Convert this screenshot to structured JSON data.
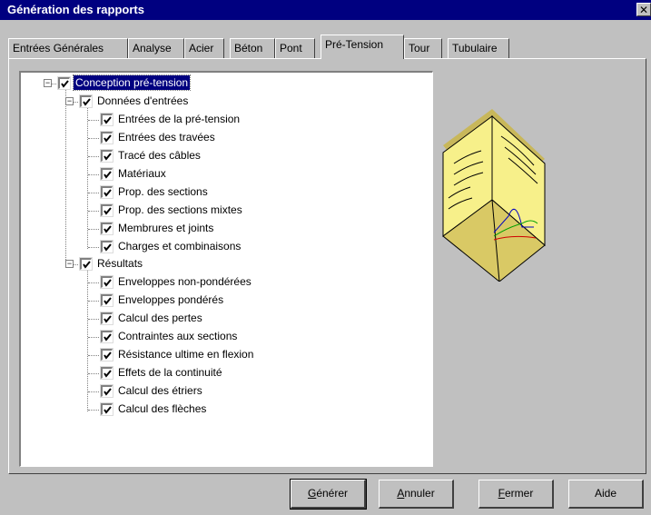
{
  "window": {
    "title": "Génération des rapports",
    "close_glyph": "✕"
  },
  "tabs": [
    {
      "label": "Entrées Générales",
      "active": false
    },
    {
      "label": "Analyse",
      "active": false
    },
    {
      "label": "Acier",
      "active": false
    },
    {
      "label": "Béton",
      "active": false
    },
    {
      "label": "Pont",
      "active": false
    },
    {
      "label": "Pré-Tension",
      "active": true
    },
    {
      "label": "Tour",
      "active": false
    },
    {
      "label": "Tubulaire",
      "active": false
    }
  ],
  "tree": {
    "root": {
      "label": "Conception pré-tension",
      "checked": true,
      "expanded": true,
      "selected": true
    },
    "groups": [
      {
        "label": "Données d'entrées",
        "checked": true,
        "expanded": true,
        "items": [
          {
            "label": "Entrées de la pré-tension",
            "checked": true
          },
          {
            "label": "Entrées des travées",
            "checked": true
          },
          {
            "label": "Tracé des câbles",
            "checked": true
          },
          {
            "label": "Matériaux",
            "checked": true
          },
          {
            "label": "Prop. des sections",
            "checked": true
          },
          {
            "label": "Prop. des sections mixtes",
            "checked": true
          },
          {
            "label": "Membrures et joints",
            "checked": true
          },
          {
            "label": "Charges et combinaisons",
            "checked": true
          }
        ]
      },
      {
        "label": "Résultats",
        "checked": true,
        "expanded": true,
        "items": [
          {
            "label": "Enveloppes non-pondérées",
            "checked": true
          },
          {
            "label": "Enveloppes pondérés",
            "checked": true
          },
          {
            "label": "Calcul des pertes",
            "checked": true
          },
          {
            "label": "Contraintes aux sections",
            "checked": true
          },
          {
            "label": "Résistance ultime en flexion",
            "checked": true
          },
          {
            "label": "Effets de la continuité",
            "checked": true
          },
          {
            "label": "Calcul des étriers",
            "checked": true
          },
          {
            "label": "Calcul des flèches",
            "checked": true
          }
        ]
      }
    ]
  },
  "buttons": {
    "generate": {
      "mnemonic": "G",
      "rest": "énérer"
    },
    "cancel": {
      "mnemonic": "A",
      "rest": "nnuler"
    },
    "close": {
      "mnemonic": "F",
      "rest": "ermer"
    },
    "help": {
      "label": "Aide"
    }
  },
  "illustration": {
    "icon": "open-book-report-icon"
  },
  "colors": {
    "titlebar": "#000080",
    "face": "#c0c0c0",
    "selection": "#000080",
    "book": "#f7f08a"
  }
}
